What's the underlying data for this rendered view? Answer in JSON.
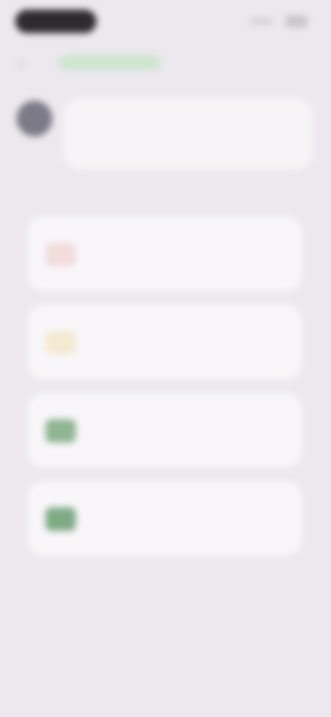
{
  "status_bar": {
    "time": "",
    "signal_icon": "signal-icon",
    "battery_icon": "battery-icon"
  },
  "header": {
    "back_icon": "back-arrow-icon",
    "link_label": ""
  },
  "bot": {
    "avatar_icon": "bot-avatar",
    "message": ""
  },
  "options": [
    {
      "icon": "heart-icon",
      "icon_color": "#f2dcdc",
      "title": "",
      "description": ""
    },
    {
      "icon": "star-icon",
      "icon_color": "#f3ead2",
      "title": "",
      "description": ""
    },
    {
      "icon": "leaf-icon",
      "icon_color": "#8fb592",
      "title": "",
      "description": ""
    },
    {
      "icon": "check-icon",
      "icon_color": "#7faa84",
      "title": "",
      "description": ""
    }
  ],
  "colors": {
    "background": "#ece8ee",
    "card": "#f8f6f9",
    "accent": "#cfe6cf"
  }
}
